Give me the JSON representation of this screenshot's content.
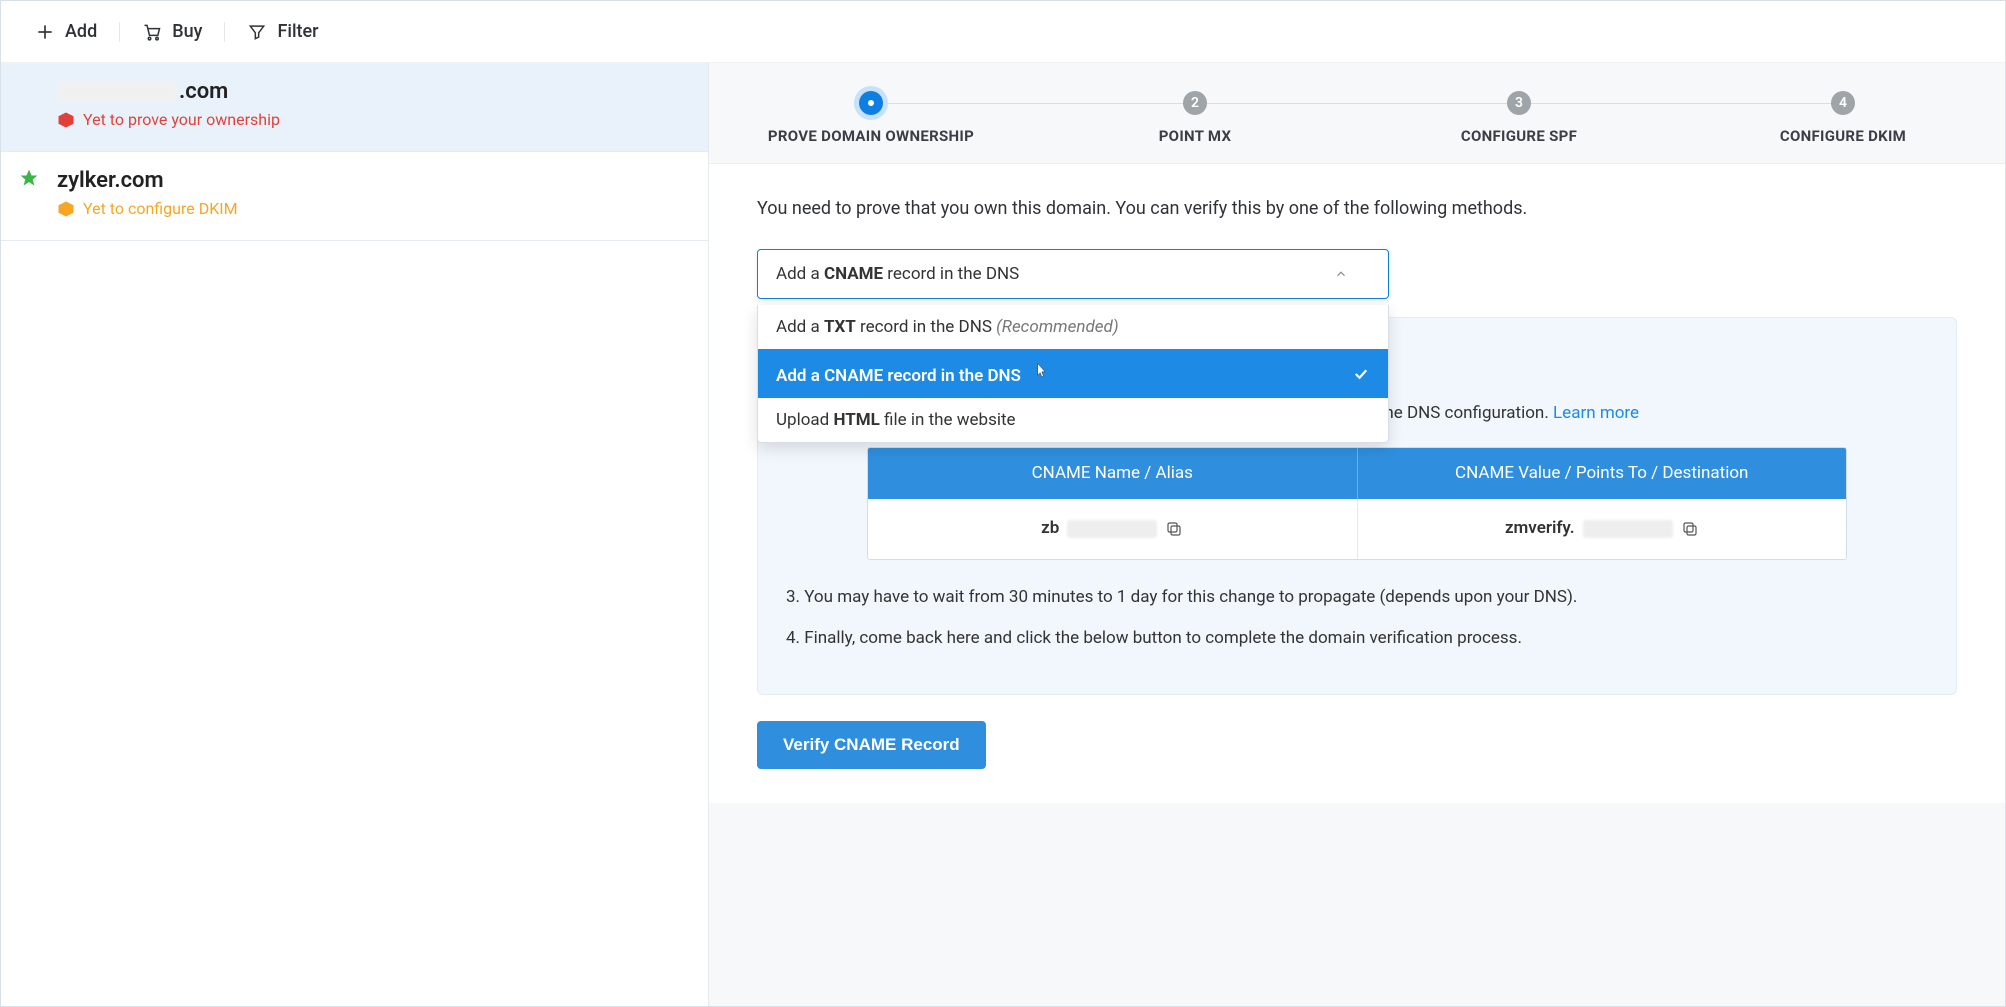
{
  "toolbar": {
    "add": "Add",
    "buy": "Buy",
    "filter": "Filter"
  },
  "sidebar": {
    "domains": [
      {
        "name_visible_suffix": ".com",
        "status": "Yet to prove your ownership",
        "status_color": "red",
        "active": true,
        "starred": false
      },
      {
        "name": "zylker.com",
        "status": "Yet to configure DKIM",
        "status_color": "orange",
        "active": false,
        "starred": true
      }
    ]
  },
  "stepper": [
    {
      "num": "",
      "label": "PROVE DOMAIN OWNERSHIP",
      "active": true
    },
    {
      "num": "2",
      "label": "POINT MX",
      "active": false
    },
    {
      "num": "3",
      "label": "CONFIGURE SPF",
      "active": false
    },
    {
      "num": "4",
      "label": "CONFIGURE DKIM",
      "active": false
    }
  ],
  "body": {
    "instruction": "You need to prove that you own this domain. You can verify this by one of the following methods.",
    "select": {
      "display_pre": "Add a ",
      "display_bold": "CNAME",
      "display_post": " record in the DNS",
      "options": [
        {
          "pre": "Add a ",
          "bold": "TXT",
          "post": " record in the DNS ",
          "suffix_em": "(Recommended)",
          "selected": false
        },
        {
          "full": "Add a CNAME record in the DNS",
          "selected": true
        },
        {
          "pre": "Upload ",
          "bold": "HTML",
          "post": " file in the website",
          "selected": false
        }
      ]
    },
    "card": {
      "partial_text_end": "to the DNS configuration. ",
      "learn_more": "Learn more",
      "table": {
        "head1": "CNAME Name / Alias",
        "head2": "CNAME Value / Points To / Destination",
        "val1_prefix": "zb",
        "val2_prefix": "zmverify."
      },
      "step3": "3. You may have to wait from 30 minutes to 1 day for this change to propagate (depends upon your DNS).",
      "step4": "4. Finally, come back here and click the below button to complete the domain verification process."
    },
    "verify_button": "Verify CNAME Record"
  }
}
